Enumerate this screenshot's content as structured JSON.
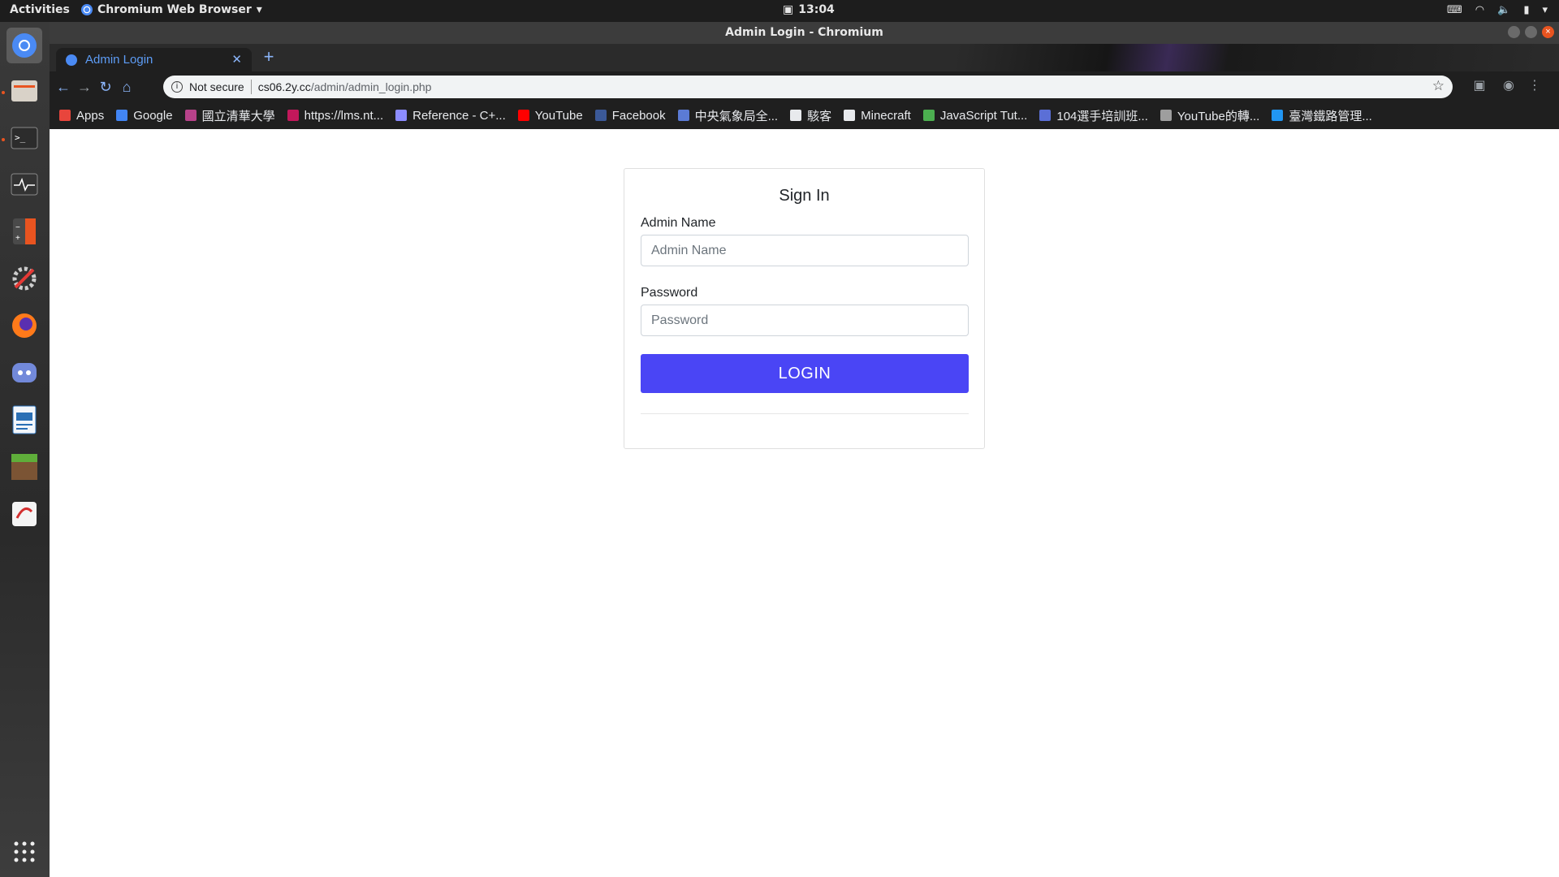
{
  "topbar": {
    "activities": "Activities",
    "app_name": "Chromium Web Browser",
    "clock": "13:04"
  },
  "window": {
    "title": "Admin Login - Chromium"
  },
  "tab": {
    "title": "Admin Login"
  },
  "omnibox": {
    "security": "Not secure",
    "url_host": "cs06.2y.cc",
    "url_path": "/admin/admin_login.php"
  },
  "bookmarks": [
    {
      "label": "Apps",
      "color": "#e8453c"
    },
    {
      "label": "Google",
      "color": "#4285f4"
    },
    {
      "label": "國立清華大學",
      "color": "#b8428a"
    },
    {
      "label": "https://lms.nt...",
      "color": "#c2185b"
    },
    {
      "label": "Reference - C+...",
      "color": "#8c8cff"
    },
    {
      "label": "YouTube",
      "color": "#ff0000"
    },
    {
      "label": "Facebook",
      "color": "#3b5998"
    },
    {
      "label": "中央氣象局全...",
      "color": "#5b7bd5"
    },
    {
      "label": "駭客",
      "color": "#e8eaed"
    },
    {
      "label": "Minecraft",
      "color": "#e8eaed"
    },
    {
      "label": "JavaScript Tut...",
      "color": "#4caf50"
    },
    {
      "label": "104選手培訓班...",
      "color": "#5b6fd6"
    },
    {
      "label": "YouTube的轉...",
      "color": "#9e9e9e"
    },
    {
      "label": "臺灣鐵路管理...",
      "color": "#2196f3"
    }
  ],
  "form": {
    "heading": "Sign In",
    "admin_label": "Admin Name",
    "admin_placeholder": "Admin Name",
    "password_label": "Password",
    "password_placeholder": "Password",
    "login_button": "LOGIN"
  },
  "colors": {
    "login_button": "#4a45f5",
    "dock_running_dot": "#e95420"
  }
}
